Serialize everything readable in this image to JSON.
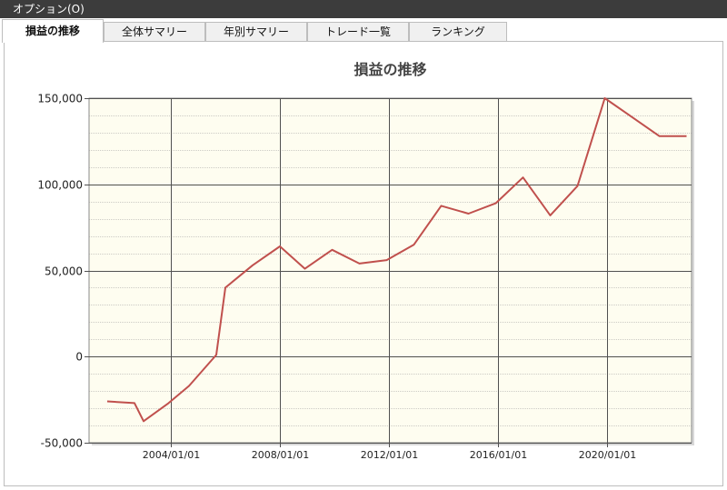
{
  "window": {
    "title": "オプション(O)"
  },
  "tabs": [
    {
      "label": "損益の推移",
      "active": true
    },
    {
      "label": "全体サマリー",
      "active": false
    },
    {
      "label": "年別サマリー",
      "active": false
    },
    {
      "label": "トレード一覧",
      "active": false
    },
    {
      "label": "ランキング",
      "active": false
    }
  ],
  "colors": {
    "plot_background": "#fefdf0",
    "line": "#c0504d"
  },
  "chart_data": {
    "type": "line",
    "title": "損益の推移",
    "xlabel": "",
    "ylabel": "",
    "ylim": [
      -50000,
      150000
    ],
    "y_ticks": [
      "150,000",
      "100,000",
      "50,000",
      "0",
      "-50,000"
    ],
    "x_ticks": [
      "2004/01/01",
      "2008/01/01",
      "2012/01/01",
      "2016/01/01",
      "2020/01/01"
    ],
    "grid": true,
    "series": [
      {
        "x": [
          "2001/09",
          "2002/09",
          "2003/01",
          "2003/12",
          "2004/09",
          "2005/09",
          "2006/01",
          "2007/01",
          "2008/01",
          "2008/12",
          "2009/12",
          "2010/12",
          "2011/12",
          "2012/12",
          "2013/12",
          "2014/12",
          "2015/12",
          "2016/12",
          "2017/12",
          "2018/12",
          "2019/12",
          "2020/12",
          "2021/12",
          "2022/12"
        ],
        "values": [
          -26000,
          -27000,
          -37500,
          -27000,
          -17000,
          1000,
          40000,
          53000,
          64000,
          51000,
          62000,
          54000,
          56000,
          65000,
          87500,
          83000,
          89000,
          104000,
          82000,
          99000,
          150000,
          139000,
          128000,
          128000
        ]
      }
    ]
  }
}
